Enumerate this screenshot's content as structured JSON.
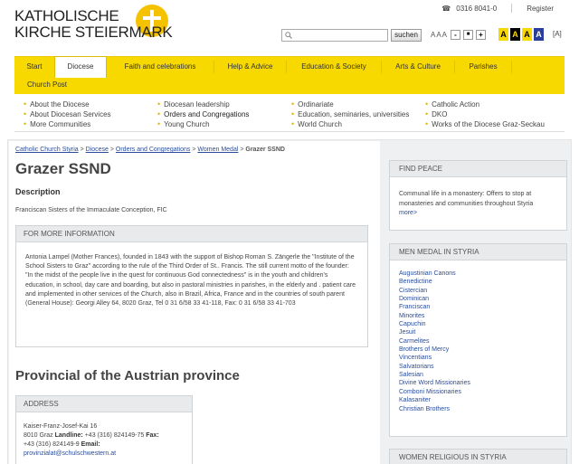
{
  "header": {
    "logo_line1": "KATHOLISCHE",
    "logo_line2": "KIRCHE STEIERMARK",
    "phone": "0316 8041-0",
    "register": "Register",
    "search_button": "suchen",
    "fontsize_label": "AAA",
    "fontsize_minus": "-",
    "fontsize_reset": "■",
    "fontsize_plus": "+",
    "contrast": [
      "A",
      "A",
      "A",
      "A"
    ],
    "plain_link": "[A]"
  },
  "nav": {
    "items": [
      "Start",
      "Diocese",
      "Faith and celebrations",
      "Help & Advice",
      "Education & Society",
      "Arts & Culture",
      "Parishes"
    ],
    "active": "Diocese",
    "sub": "Church Post",
    "columns": [
      [
        "About the Diocese",
        "About Diocesan Services",
        "More Communities"
      ],
      [
        "Diocesan leadership",
        "Orders and Congregations",
        "Young Church"
      ],
      [
        "Ordinariate",
        "Education, seminaries, universities",
        "World Church"
      ],
      [
        "Catholic Action",
        "DKO",
        "Works of the Diocese Graz-Seckau"
      ]
    ]
  },
  "breadcrumb": {
    "items": [
      "Catholic Church Styria",
      "Diocese",
      "Orders and Congregations",
      "Women Medal"
    ],
    "current": "Grazer SSND"
  },
  "main": {
    "title": "Grazer SSND",
    "description_heading": "Description",
    "description": "Franciscan Sisters of the Immaculate Conception, FIC",
    "info_heading": "FOR MORE INFORMATION",
    "info_text": "Antonia Lampel (Mother Frances), founded in 1843 with the support of Bishop Roman S. Zängerle the \"Institute of the School Sisters to Graz\" according to the rule of the Third Order of St.. Francis. The still current motto of the founder: \"In the midst of the people live in the quest for continuous God connectedness\" is in the youth and children's education, in school, day care and boarding, but also in pastoral ministries in parishes, in the elderly and . patient care and implemented in other services of the Church, also in Brazil, Africa, France and in the countries of south parent (General House): Georgi Alley 64, 8020 Graz, Tel 0 31 6/58 33 41-118, Fax: 0 31 6/58 33 41-703",
    "province_heading": "Provincial of the Austrian province",
    "address_heading": "ADDRESS",
    "address_street": "Kaiser-Franz-Josef-Kai 16",
    "address_city": "8010 Graz",
    "landline_label": "Landline:",
    "landline": "+43 (316) 824149-75",
    "fax_label": "Fax:",
    "fax": "+43 (316) 824149-9",
    "email_label": "Email:",
    "email": "provinzialat@schulschwestern.at"
  },
  "sidebar": {
    "findpeace_heading": "FIND PEACE",
    "findpeace_text": "Communal life in a monastery: Offers to stop at monasteries and communities throughout Styria",
    "findpeace_more": "more>",
    "menmedal_heading": "MEN MEDAL IN STYRIA",
    "orders": [
      "Augustinian Canons",
      "Benedictine",
      "Cistercian",
      "Dominican",
      "Franciscan",
      "Minorites",
      "Capuchin",
      "Jesuit",
      "Carmelites",
      "Brothers of Mercy",
      "Vincentians",
      "Salvatorians",
      "Salesian",
      "Divine Word Missionaries",
      "Comboni Missionaries",
      "Kalasaniter",
      "Christian Brothers"
    ],
    "women_heading": "WOMEN RELIGIOUS IN STYRIA"
  },
  "colors": {
    "nav_yellow": "#f7d900",
    "link_blue": "#2a4d9b",
    "logo_yellow": "#f5c200"
  }
}
